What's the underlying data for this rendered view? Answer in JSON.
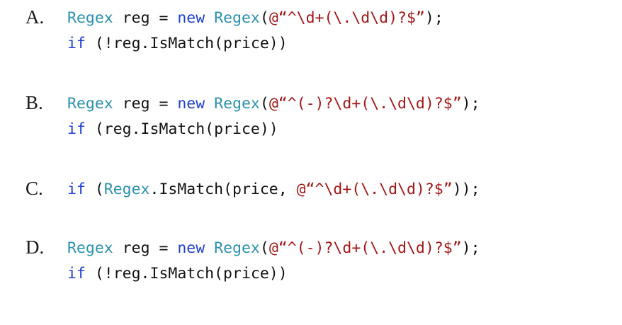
{
  "colors": {
    "type": "#2b91af",
    "keyword": "#1f3fd0",
    "string": "#a31515",
    "text": "#111111"
  },
  "options": [
    {
      "letter": "A.",
      "lines": [
        [
          {
            "kind": "type",
            "text": "Regex"
          },
          {
            "kind": "plain",
            "text": " reg = "
          },
          {
            "kind": "kw",
            "text": "new"
          },
          {
            "kind": "plain",
            "text": " "
          },
          {
            "kind": "type",
            "text": "Regex"
          },
          {
            "kind": "plain",
            "text": "("
          },
          {
            "kind": "str",
            "text": "@“^\\d+(\\.\\d\\d)?$”"
          },
          {
            "kind": "plain",
            "text": ");"
          }
        ],
        [
          {
            "kind": "kw",
            "text": "if"
          },
          {
            "kind": "plain",
            "text": " (!reg.IsMatch(price))"
          }
        ]
      ]
    },
    {
      "letter": "B.",
      "lines": [
        [
          {
            "kind": "type",
            "text": "Regex"
          },
          {
            "kind": "plain",
            "text": " reg = "
          },
          {
            "kind": "kw",
            "text": "new"
          },
          {
            "kind": "plain",
            "text": " "
          },
          {
            "kind": "type",
            "text": "Regex"
          },
          {
            "kind": "plain",
            "text": "("
          },
          {
            "kind": "str",
            "text": "@“^(-)?\\d+(\\.\\d\\d)?$”"
          },
          {
            "kind": "plain",
            "text": ");"
          }
        ],
        [
          {
            "kind": "kw",
            "text": "if"
          },
          {
            "kind": "plain",
            "text": " (reg.IsMatch(price))"
          }
        ]
      ]
    },
    {
      "letter": "C.",
      "lines": [
        [
          {
            "kind": "kw",
            "text": "if"
          },
          {
            "kind": "plain",
            "text": " ("
          },
          {
            "kind": "type",
            "text": "Regex"
          },
          {
            "kind": "plain",
            "text": ".IsMatch(price, "
          },
          {
            "kind": "str",
            "text": "@“^\\d+(\\.\\d\\d)?$”"
          },
          {
            "kind": "plain",
            "text": "));"
          }
        ]
      ]
    },
    {
      "letter": "D.",
      "lines": [
        [
          {
            "kind": "type",
            "text": "Regex"
          },
          {
            "kind": "plain",
            "text": " reg = "
          },
          {
            "kind": "kw",
            "text": "new"
          },
          {
            "kind": "plain",
            "text": " "
          },
          {
            "kind": "type",
            "text": "Regex"
          },
          {
            "kind": "plain",
            "text": "("
          },
          {
            "kind": "str",
            "text": "@“^(-)?\\d+(\\.\\d\\d)?$”"
          },
          {
            "kind": "plain",
            "text": ");"
          }
        ],
        [
          {
            "kind": "kw",
            "text": "if"
          },
          {
            "kind": "plain",
            "text": " (!reg.IsMatch(price))"
          }
        ]
      ]
    }
  ]
}
